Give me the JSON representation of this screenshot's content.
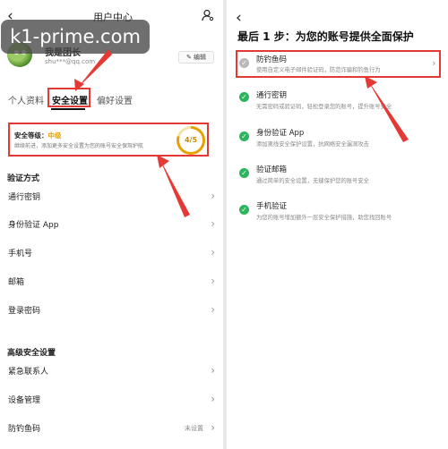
{
  "left": {
    "header_title": "用户中心",
    "back_icon": "back-arrow",
    "user_icon": "user-settings-icon",
    "watermark": "k1-prime.com",
    "nickname": "我是团长",
    "email": "shu***@qq.com",
    "edit_label": "编辑",
    "tabs": [
      {
        "label": "个人资料",
        "active": false
      },
      {
        "label": "安全设置",
        "active": true
      },
      {
        "label": "偏好设置",
        "active": false
      }
    ],
    "security": {
      "level_label": "安全等级：",
      "level_value": "中级",
      "desc": "继续前进，添加更多安全设置为您的账号安全保驾护航",
      "score": "4/5",
      "score_fraction": 0.8
    },
    "verify_heading": "验证方式",
    "verify_items": [
      {
        "label": "通行密钥"
      },
      {
        "label": "身份验证 App"
      },
      {
        "label": "手机号"
      },
      {
        "label": "邮箱"
      },
      {
        "label": "登录密码"
      }
    ],
    "advanced_heading": "高级安全设置",
    "advanced_items": [
      {
        "label": "紧急联系人",
        "value": ""
      },
      {
        "label": "设备管理",
        "value": ""
      },
      {
        "label": "防钓鱼码",
        "value": "未设置"
      }
    ],
    "accent_color": "#e6a100",
    "highlight_color": "#e53935"
  },
  "right": {
    "title": "最后 1 步：为您的账号提供全面保护",
    "items": [
      {
        "label": "防钓鱼码",
        "desc": "使用自定义电子邮件验证码，防范诈骗和钓鱼行为",
        "done": false
      },
      {
        "label": "通行密钥",
        "desc": "无需密码或验证码，轻松登录您的账号，提升账号安全",
        "done": true
      },
      {
        "label": "身份验证 App",
        "desc": "添加离线安全保护设置，抗网络安全漏洞攻击",
        "done": true
      },
      {
        "label": "验证邮箱",
        "desc": "通过简单的安全设置，无缝保护您的账号安全",
        "done": true
      },
      {
        "label": "手机验证",
        "desc": "为您的账号增加额外一层安全保护措施，助您找回账号",
        "done": true
      }
    ],
    "check_color": "#2db55d"
  }
}
